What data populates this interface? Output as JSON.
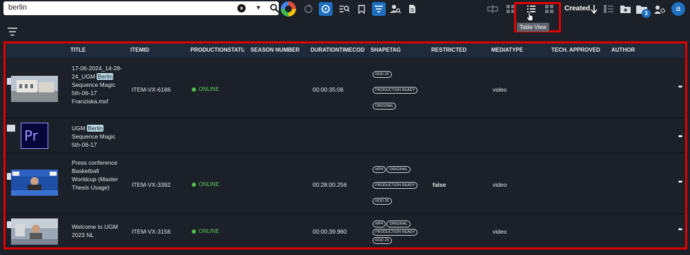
{
  "search": {
    "value": "berlin"
  },
  "toolbar": {
    "sort_label": "Created",
    "badge_count": "3",
    "user_initial": "a",
    "tooltip": "Table View"
  },
  "columns": [
    "TITLE",
    "ITEMID",
    "PRODUCTIONSTATUS",
    "SEASON NUMBER",
    "DURATIONTIMECODE",
    "SHAPETAG",
    "RESTRICTED",
    "MEDIATYPE",
    "TECH. APPROVED",
    "AUTHOR"
  ],
  "rows": [
    {
      "title_pre": "17-06-2024_14-28-24_UGM",
      "title_hl": "Berlin",
      "title_post": "Sequence Magic 5th-06-17 Franziska.mxf",
      "itemid": "ITEM-VX-6186",
      "status": "ONLINE",
      "duration": "00:00:35:06",
      "tags": [
        [
          "RDD 25"
        ],
        [
          "PRODUCTION READY"
        ],
        [
          "ORIGINAL"
        ]
      ],
      "restricted": "",
      "mediatype": "video"
    },
    {
      "title_pre": "UGM",
      "title_hl": "Berlin",
      "title_post": "Sequence Magic 5th-06-17",
      "itemid": "",
      "status": "",
      "duration": "",
      "tags": [],
      "restricted": "",
      "mediatype": "",
      "thumb_label": "Pr"
    },
    {
      "title_pre": "Press conference Basketball Worldcup (Master Thesis Usage)",
      "title_hl": "",
      "title_post": "",
      "itemid": "ITEM-VX-3392",
      "status": "ONLINE",
      "duration": "00:28:00.256",
      "tags": [
        [
          "MP4",
          "ORIGINAL"
        ],
        [
          "PRODUCTION READY"
        ],
        [
          "RDD 25"
        ]
      ],
      "restricted": "false",
      "mediatype": "video"
    },
    {
      "title_pre": "Welcome to UGM 2023 NL",
      "title_hl": "",
      "title_post": "",
      "itemid": "ITEM-VX-3156",
      "status": "ONLINE",
      "duration": "00:00:39.960",
      "tags": [
        [
          "MP4",
          "ORIGINAL"
        ],
        [
          "PRODUCTION READY"
        ],
        [
          "RDD 25"
        ]
      ],
      "restricted": "",
      "mediatype": "video"
    }
  ],
  "icons": [
    "search-icon",
    "clear-icon",
    "dropdown-icon",
    "refresh-icon",
    "sync-icon",
    "search-list-icon",
    "bookmark-icon",
    "filter-icon",
    "user-search-icon",
    "document-icon",
    "split-icon",
    "grid-icon",
    "list-icon",
    "sort-down-icon",
    "add-folder-icon",
    "folders-icon",
    "user-settings-icon",
    "more-icon",
    "clapper-icon"
  ],
  "colors": {
    "accent": "#1e6fc0",
    "online": "#4fc24a",
    "highlight_box": "#e00000",
    "header_bg": "#1f2a3a"
  }
}
